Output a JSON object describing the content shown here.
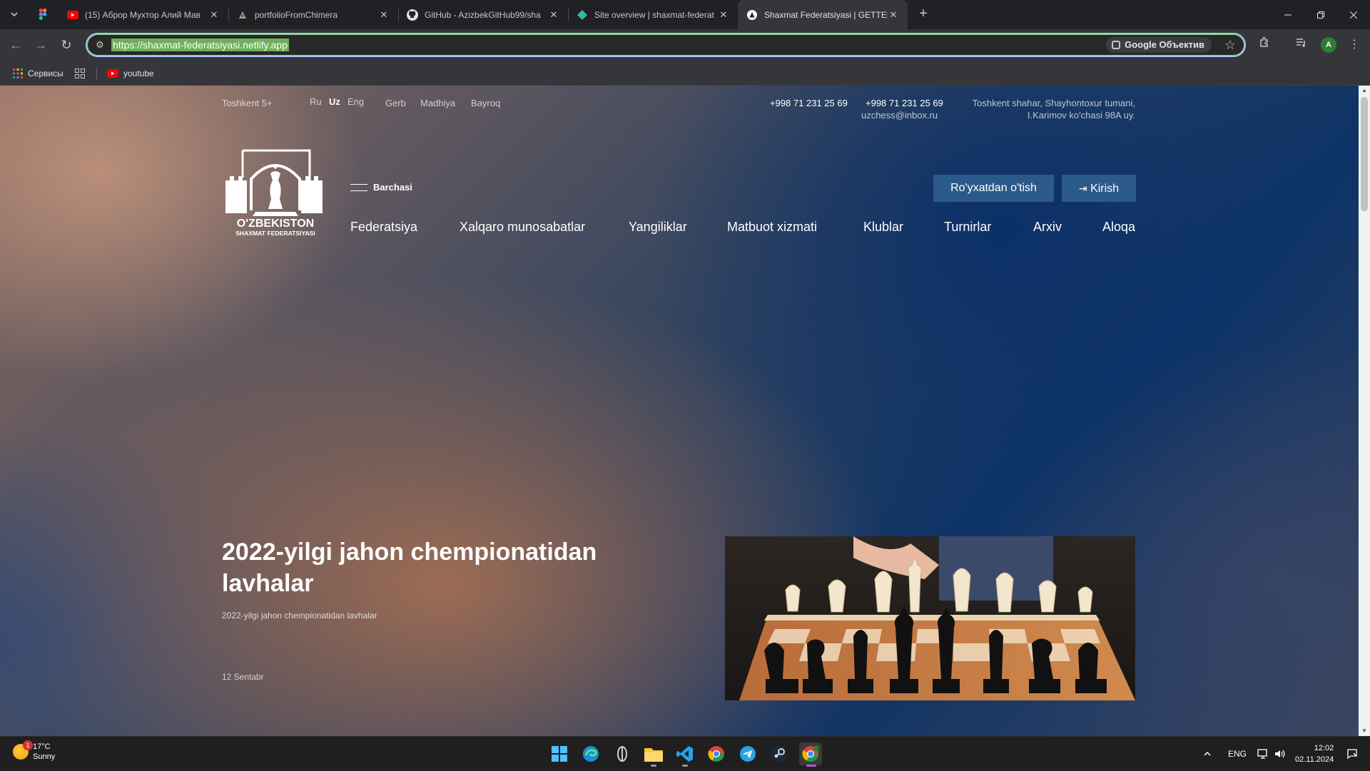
{
  "browser": {
    "tabs": [
      {
        "title": "(15) Аброр Мухтор Алий Мав",
        "icon": "youtube-icon"
      },
      {
        "title": "portfolioFromChimera",
        "icon": "chimera-icon"
      },
      {
        "title": "GitHub - AzizbekGitHub99/sha",
        "icon": "github-icon"
      },
      {
        "title": "Site overview | shaxmat-federat",
        "icon": "netlify-icon"
      },
      {
        "title": "Shaxmat Federatsiyasi | GETTER",
        "icon": "getter-icon",
        "active": true
      }
    ],
    "url": "https://shaxmat-federatsiyasi.netlify.app",
    "lens_label": "Google Объектив",
    "profile_initial": "A",
    "bookmarks": [
      {
        "label": "Сервисы",
        "icon": "apps-grid-icon"
      },
      {
        "label": "youtube",
        "icon": "youtube-icon"
      }
    ]
  },
  "site": {
    "top_bar": {
      "weather": "Toshkent 5+",
      "languages": [
        {
          "label": "Ru"
        },
        {
          "label": "Uz",
          "active": true
        },
        {
          "label": "Eng"
        }
      ],
      "symbols": [
        "Gerb",
        "Madhiya",
        "Bayroq"
      ],
      "phone_1": "+998 71 231 25 69",
      "phone_2": "+998 71 231 25 69",
      "email": "uzchess@inbox.ru",
      "address_line_1": "Toshkent shahar, Shayhontoxur tumani,",
      "address_line_2": "I.Karimov ko'chasi 98A uy."
    },
    "logo": {
      "line_1": "O'ZBEKISTON",
      "line_2": "SHAXMAT FEDERATSIYASI"
    },
    "all_menu_label": "Barchasi",
    "nav": [
      "Federatsiya",
      "Xalqaro munosabatlar",
      "Yangiliklar",
      "Matbuot xizmati",
      "Klublar",
      "Turnirlar",
      "Arxiv",
      "Aloqa"
    ],
    "register_button": "Ro'yxatdan o'tish",
    "login_button": "Kirish",
    "hero": {
      "title": "2022-yilgi jahon chempionatidan lavhalar",
      "subtitle": "2022-yilgi jahon chempionatidan lavhalar",
      "date": "12 Sentabr"
    }
  },
  "taskbar": {
    "weather_temp": "17°C",
    "weather_text": "Sunny",
    "weather_badge": "1",
    "apps": [
      "windows-start-icon",
      "edge-icon",
      "app-icon",
      "file-explorer-icon",
      "vscode-icon",
      "chrome-icon",
      "telegram-icon",
      "steam-icon",
      "chrome-profile-icon"
    ],
    "lang": "ENG",
    "time": "12:02",
    "date": "02.11.2024"
  }
}
